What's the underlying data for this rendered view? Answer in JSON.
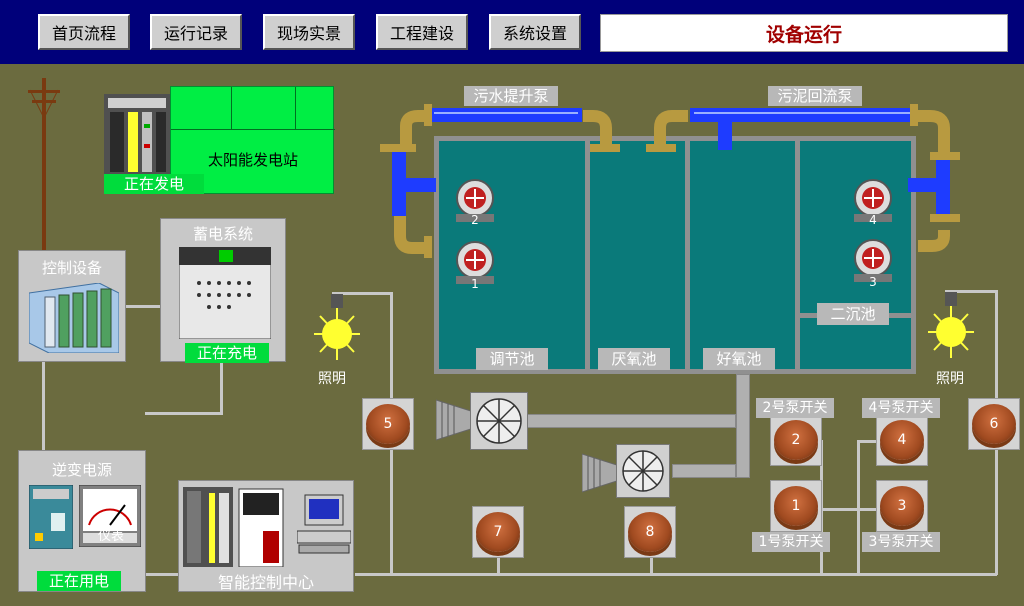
{
  "nav": [
    "首页流程",
    "运行记录",
    "现场实景",
    "工程建设",
    "系统设置"
  ],
  "title": "设备运行",
  "solar": {
    "title": "太阳能发电站",
    "status": "正在发电"
  },
  "storage": {
    "title": "蓄电系统",
    "status": "正在充电"
  },
  "control": {
    "title": "控制设备"
  },
  "inverter": {
    "title": "逆变电源",
    "status": "正在用电",
    "meter_label": "仪表"
  },
  "center": {
    "title": "智能控制中心"
  },
  "pipes": {
    "sewage_lift": "污水提升泵",
    "sludge_return": "污泥回流泵"
  },
  "tanks": [
    "调节池",
    "厌氧池",
    "好氧池",
    "二沉池"
  ],
  "pumps": [
    "1",
    "2",
    "3",
    "4"
  ],
  "lights": [
    "照明",
    "照明"
  ],
  "buttons": [
    "1",
    "2",
    "3",
    "4",
    "5",
    "6",
    "7",
    "8"
  ],
  "switches": {
    "pump1": "1号泵开关",
    "pump2": "2号泵开关",
    "pump3": "3号泵开关",
    "pump4": "4号泵开关"
  },
  "colors": {
    "water": "#0a7a7a",
    "pipe": "#1e3cff",
    "status": "#00dc3c",
    "title": "#a00000"
  }
}
